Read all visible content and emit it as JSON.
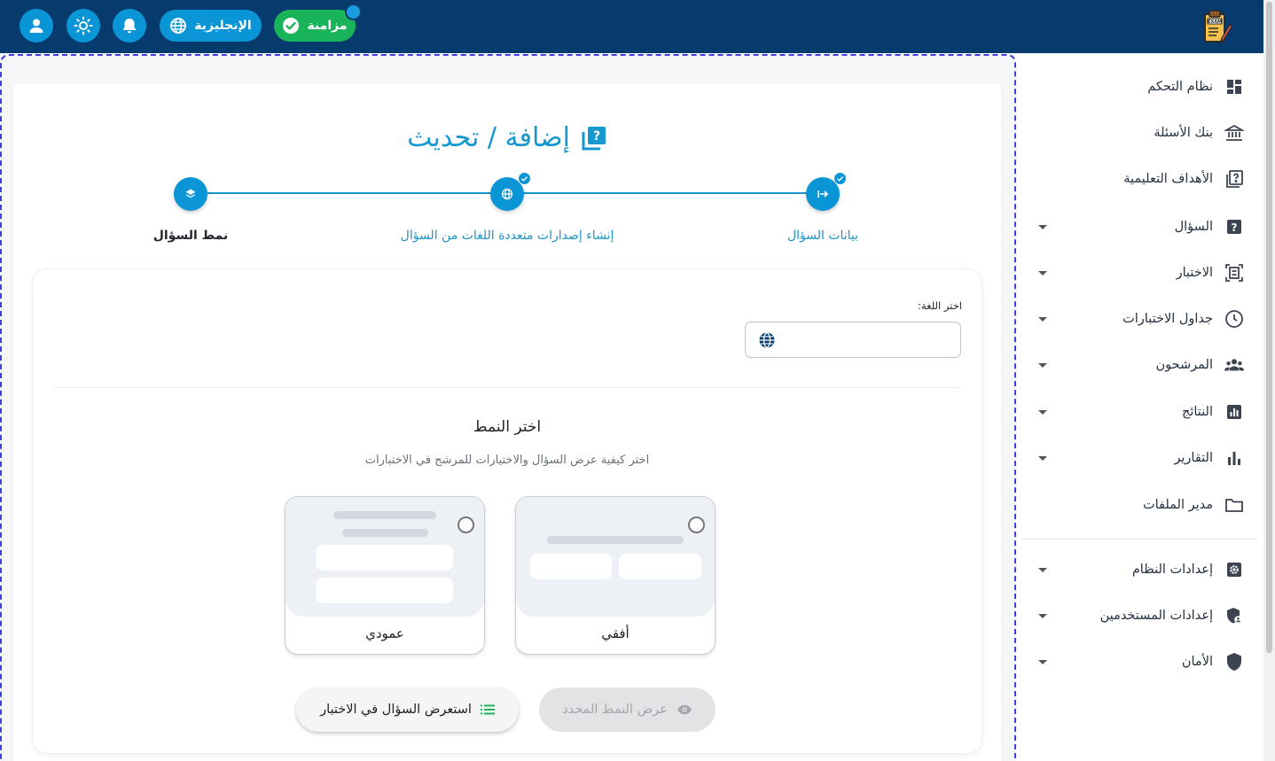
{
  "header": {
    "language_button": "الإنجليزية",
    "sync_button": "مزامنة",
    "icons": [
      "user-icon",
      "sun-icon",
      "bell-icon",
      "globe-icon",
      "check-circle-icon",
      "exam-logo-icon"
    ]
  },
  "sidebar": {
    "items": [
      {
        "label": "نظام التحكم",
        "icon": "dashboard-icon",
        "caret": false
      },
      {
        "label": "بنك الأسئلة",
        "icon": "bank-icon",
        "caret": false
      },
      {
        "label": "الأهداف التعليمية",
        "icon": "book-question-icon",
        "caret": false
      },
      {
        "label": "السؤال",
        "icon": "question-icon",
        "caret": true
      },
      {
        "label": "الاختبار",
        "icon": "exam-icon",
        "caret": true
      },
      {
        "label": "جداول الاختبارات",
        "icon": "clock-icon",
        "caret": true
      },
      {
        "label": "المرشحون",
        "icon": "people-icon",
        "caret": true
      },
      {
        "label": "النتائج",
        "icon": "chart-box-icon",
        "caret": true
      },
      {
        "label": "التقارير",
        "icon": "bar-chart-icon",
        "caret": true
      },
      {
        "label": "مدير الملفات",
        "icon": "folder-icon",
        "caret": false
      },
      {
        "label": "إعدادات النظام",
        "icon": "settings-icon",
        "caret": true
      },
      {
        "label": "إعدادات المستخدمين",
        "icon": "user-shield-icon",
        "caret": true
      },
      {
        "label": "الأمان",
        "icon": "shield-icon",
        "caret": true
      }
    ]
  },
  "main": {
    "title": "إضافة / تحديث",
    "steps": [
      {
        "label": "بيانات السؤال",
        "done": true
      },
      {
        "label": "إنشاء إصدارات متعددة اللغات من السؤال",
        "done": true
      },
      {
        "label": "نمط السؤال",
        "done": false,
        "active": true
      }
    ],
    "language_label": "اختر اللغة:",
    "language_value": "",
    "choose_title": "اختر النمط",
    "choose_subtitle": "اختر كيفية عرض السؤال والاختيارات للمرشح في الاختبارات",
    "layouts": [
      {
        "label": "أفقي",
        "selected": false
      },
      {
        "label": "عمودي",
        "selected": false
      }
    ],
    "preview_button": "عرض النمط المحدد",
    "review_button": "استعرض السؤال في الاختبار"
  },
  "colors": {
    "topbar": "#073b6e",
    "accent": "#0a95d6",
    "sync": "#19b45a"
  }
}
